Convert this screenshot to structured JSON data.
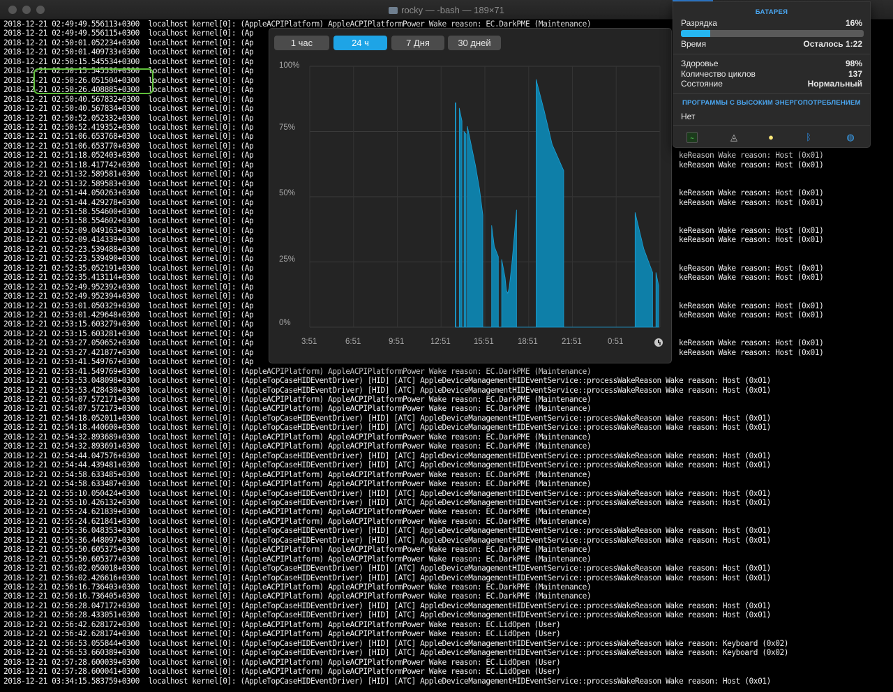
{
  "window": {
    "title": "rocky — -bash — 189×71"
  },
  "terminal": {
    "lines": [
      "2018-12-21 02:49:49.556113+0300  localhost kernel[0]: (AppleACPIPlatform) AppleACPIPlatformPower Wake reason: EC.DarkPME (Maintenance)",
      "2018-12-21 02:49:49.556115+0300  localhost kernel[0]: (Ap",
      "2018-12-21 02:50:01.052234+0300  localhost kernel[0]: (Ap",
      "2018-12-21 02:50:01.409733+0300  localhost kernel[0]: (Ap",
      "2018-12-21 02:50:15.545534+0300  localhost kernel[0]: (Ap",
      "2018-12-21 02:50:15.545536+0300  localhost kernel[0]: (Ap",
      "2018-12-21 02:50:26.051504+0300  localhost kernel[0]: (Ap",
      "2018-12-21 02:50:26.408885+0300  localhost kernel[0]: (Ap",
      "2018-12-21 02:50:40.567832+0300  localhost kernel[0]: (Ap",
      "2018-12-21 02:50:40.567834+0300  localhost kernel[0]: (Ap",
      "2018-12-21 02:50:52.052332+0300  localhost kernel[0]: (Ap",
      "2018-12-21 02:50:52.419352+0300  localhost kernel[0]: (Ap",
      "2018-12-21 02:51:06.653768+0300  localhost kernel[0]: (Ap",
      "2018-12-21 02:51:06.653770+0300  localhost kernel[0]: (Ap",
      "2018-12-21 02:51:18.052403+0300  localhost kernel[0]: (Ap                                                                                                 keReason Wake reason: Host (0x01)",
      "2018-12-21 02:51:18.417742+0300  localhost kernel[0]: (Ap                                                                                                 keReason Wake reason: Host (0x01)",
      "2018-12-21 02:51:32.589581+0300  localhost kernel[0]: (Ap",
      "2018-12-21 02:51:32.589583+0300  localhost kernel[0]: (Ap",
      "2018-12-21 02:51:44.050263+0300  localhost kernel[0]: (Ap                                                                                                 keReason Wake reason: Host (0x01)",
      "2018-12-21 02:51:44.429278+0300  localhost kernel[0]: (Ap                                                                                                 keReason Wake reason: Host (0x01)",
      "2018-12-21 02:51:58.554600+0300  localhost kernel[0]: (Ap",
      "2018-12-21 02:51:58.554602+0300  localhost kernel[0]: (Ap",
      "2018-12-21 02:52:09.049163+0300  localhost kernel[0]: (Ap                                                                                                 keReason Wake reason: Host (0x01)",
      "2018-12-21 02:52:09.414339+0300  localhost kernel[0]: (Ap                                                                                                 keReason Wake reason: Host (0x01)",
      "2018-12-21 02:52:23.539488+0300  localhost kernel[0]: (Ap",
      "2018-12-21 02:52:23.539490+0300  localhost kernel[0]: (Ap",
      "2018-12-21 02:52:35.052191+0300  localhost kernel[0]: (Ap                                                                                                 keReason Wake reason: Host (0x01)",
      "2018-12-21 02:52:35.413114+0300  localhost kernel[0]: (Ap                                                                                                 keReason Wake reason: Host (0x01)",
      "2018-12-21 02:52:49.952392+0300  localhost kernel[0]: (Ap",
      "2018-12-21 02:52:49.952394+0300  localhost kernel[0]: (Ap",
      "2018-12-21 02:53:01.050329+0300  localhost kernel[0]: (Ap                                                                                                 keReason Wake reason: Host (0x01)",
      "2018-12-21 02:53:01.429648+0300  localhost kernel[0]: (Ap                                                                                                 keReason Wake reason: Host (0x01)",
      "2018-12-21 02:53:15.603279+0300  localhost kernel[0]: (Ap",
      "2018-12-21 02:53:15.603281+0300  localhost kernel[0]: (Ap",
      "2018-12-21 02:53:27.050652+0300  localhost kernel[0]: (Ap                                                                                                 keReason Wake reason: Host (0x01)",
      "2018-12-21 02:53:27.421877+0300  localhost kernel[0]: (Ap                                                                                                 keReason Wake reason: Host (0x01)",
      "2018-12-21 02:53:41.549767+0300  localhost kernel[0]: (Ap",
      "2018-12-21 02:53:41.549769+0300  localhost kernel[0]: (AppleACPIPlatform) AppleACPIPlatformPower Wake reason: EC.DarkPME (Maintenance)",
      "2018-12-21 02:53:53.048098+0300  localhost kernel[0]: (AppleTopCaseHIDEventDriver) [HID] [ATC] AppleDeviceManagementHIDEventService::processWakeReason Wake reason: Host (0x01)",
      "2018-12-21 02:53:53.428430+0300  localhost kernel[0]: (AppleTopCaseHIDEventDriver) [HID] [ATC] AppleDeviceManagementHIDEventService::processWakeReason Wake reason: Host (0x01)",
      "2018-12-21 02:54:07.572171+0300  localhost kernel[0]: (AppleACPIPlatform) AppleACPIPlatformPower Wake reason: EC.DarkPME (Maintenance)",
      "2018-12-21 02:54:07.572173+0300  localhost kernel[0]: (AppleACPIPlatform) AppleACPIPlatformPower Wake reason: EC.DarkPME (Maintenance)",
      "2018-12-21 02:54:18.052011+0300  localhost kernel[0]: (AppleTopCaseHIDEventDriver) [HID] [ATC] AppleDeviceManagementHIDEventService::processWakeReason Wake reason: Host (0x01)",
      "2018-12-21 02:54:18.440600+0300  localhost kernel[0]: (AppleTopCaseHIDEventDriver) [HID] [ATC] AppleDeviceManagementHIDEventService::processWakeReason Wake reason: Host (0x01)",
      "2018-12-21 02:54:32.893689+0300  localhost kernel[0]: (AppleACPIPlatform) AppleACPIPlatformPower Wake reason: EC.DarkPME (Maintenance)",
      "2018-12-21 02:54:32.893691+0300  localhost kernel[0]: (AppleACPIPlatform) AppleACPIPlatformPower Wake reason: EC.DarkPME (Maintenance)",
      "2018-12-21 02:54:44.047576+0300  localhost kernel[0]: (AppleTopCaseHIDEventDriver) [HID] [ATC] AppleDeviceManagementHIDEventService::processWakeReason Wake reason: Host (0x01)",
      "2018-12-21 02:54:44.439481+0300  localhost kernel[0]: (AppleTopCaseHIDEventDriver) [HID] [ATC] AppleDeviceManagementHIDEventService::processWakeReason Wake reason: Host (0x01)",
      "2018-12-21 02:54:58.633485+0300  localhost kernel[0]: (AppleACPIPlatform) AppleACPIPlatformPower Wake reason: EC.DarkPME (Maintenance)",
      "2018-12-21 02:54:58.633487+0300  localhost kernel[0]: (AppleACPIPlatform) AppleACPIPlatformPower Wake reason: EC.DarkPME (Maintenance)",
      "2018-12-21 02:55:10.050424+0300  localhost kernel[0]: (AppleTopCaseHIDEventDriver) [HID] [ATC] AppleDeviceManagementHIDEventService::processWakeReason Wake reason: Host (0x01)",
      "2018-12-21 02:55:10.426132+0300  localhost kernel[0]: (AppleTopCaseHIDEventDriver) [HID] [ATC] AppleDeviceManagementHIDEventService::processWakeReason Wake reason: Host (0x01)",
      "2018-12-21 02:55:24.621839+0300  localhost kernel[0]: (AppleACPIPlatform) AppleACPIPlatformPower Wake reason: EC.DarkPME (Maintenance)",
      "2018-12-21 02:55:24.621841+0300  localhost kernel[0]: (AppleACPIPlatform) AppleACPIPlatformPower Wake reason: EC.DarkPME (Maintenance)",
      "2018-12-21 02:55:36.048353+0300  localhost kernel[0]: (AppleTopCaseHIDEventDriver) [HID] [ATC] AppleDeviceManagementHIDEventService::processWakeReason Wake reason: Host (0x01)",
      "2018-12-21 02:55:36.448097+0300  localhost kernel[0]: (AppleTopCaseHIDEventDriver) [HID] [ATC] AppleDeviceManagementHIDEventService::processWakeReason Wake reason: Host (0x01)",
      "2018-12-21 02:55:50.605375+0300  localhost kernel[0]: (AppleACPIPlatform) AppleACPIPlatformPower Wake reason: EC.DarkPME (Maintenance)",
      "2018-12-21 02:55:50.605377+0300  localhost kernel[0]: (AppleACPIPlatform) AppleACPIPlatformPower Wake reason: EC.DarkPME (Maintenance)",
      "2018-12-21 02:56:02.050018+0300  localhost kernel[0]: (AppleTopCaseHIDEventDriver) [HID] [ATC] AppleDeviceManagementHIDEventService::processWakeReason Wake reason: Host (0x01)",
      "2018-12-21 02:56:02.426616+0300  localhost kernel[0]: (AppleTopCaseHIDEventDriver) [HID] [ATC] AppleDeviceManagementHIDEventService::processWakeReason Wake reason: Host (0x01)",
      "2018-12-21 02:56:16.736403+0300  localhost kernel[0]: (AppleACPIPlatform) AppleACPIPlatformPower Wake reason: EC.DarkPME (Maintenance)",
      "2018-12-21 02:56:16.736405+0300  localhost kernel[0]: (AppleACPIPlatform) AppleACPIPlatformPower Wake reason: EC.DarkPME (Maintenance)",
      "2018-12-21 02:56:28.047172+0300  localhost kernel[0]: (AppleTopCaseHIDEventDriver) [HID] [ATC] AppleDeviceManagementHIDEventService::processWakeReason Wake reason: Host (0x01)",
      "2018-12-21 02:56:28.433051+0300  localhost kernel[0]: (AppleTopCaseHIDEventDriver) [HID] [ATC] AppleDeviceManagementHIDEventService::processWakeReason Wake reason: Host (0x01)",
      "2018-12-21 02:56:42.628172+0300  localhost kernel[0]: (AppleACPIPlatform) AppleACPIPlatformPower Wake reason: EC.LidOpen (User)",
      "2018-12-21 02:56:42.628174+0300  localhost kernel[0]: (AppleACPIPlatform) AppleACPIPlatformPower Wake reason: EC.LidOpen (User)",
      "2018-12-21 02:56:53.055844+0300  localhost kernel[0]: (AppleTopCaseHIDEventDriver) [HID] [ATC] AppleDeviceManagementHIDEventService::processWakeReason Wake reason: Keyboard (0x02)",
      "2018-12-21 02:56:53.660389+0300  localhost kernel[0]: (AppleTopCaseHIDEventDriver) [HID] [ATC] AppleDeviceManagementHIDEventService::processWakeReason Wake reason: Keyboard (0x02)",
      "2018-12-21 02:57:28.600039+0300  localhost kernel[0]: (AppleACPIPlatform) AppleACPIPlatformPower Wake reason: EC.LidOpen (User)",
      "2018-12-21 02:57:28.600041+0300  localhost kernel[0]: (AppleACPIPlatform) AppleACPIPlatformPower Wake reason: EC.LidOpen (User)",
      "2018-12-21 03:34:15.583759+0300  localhost kernel[0]: (AppleTopCaseHIDEventDriver) [HID] [ATC] AppleDeviceManagementHIDEventService::processWakeReason Wake reason: Host (0x01)"
    ]
  },
  "history_popup": {
    "range_buttons": [
      "1 час",
      "24 ч",
      "7 Дня",
      "30 дней"
    ],
    "active_range": "24 ч",
    "clock_icon": "clock-icon"
  },
  "chart_data": {
    "type": "area",
    "title": "",
    "xlabel": "",
    "ylabel": "",
    "ylim": [
      0,
      100
    ],
    "yticks": [
      "100%",
      "75%",
      "50%",
      "25%",
      "0%"
    ],
    "xticks": [
      "3:51",
      "6:51",
      "9:51",
      "12:51",
      "15:51",
      "18:51",
      "21:51",
      "0:51"
    ],
    "grid": true,
    "fill_color": "#0e7fa8",
    "series": [
      {
        "values": [
          [
            10.8,
            86
          ],
          [
            10.85,
            86
          ],
          [
            10.85,
            0
          ],
          [
            11.1,
            0
          ],
          [
            11.1,
            84
          ],
          [
            11.3,
            79
          ],
          [
            11.3,
            0
          ],
          [
            11.45,
            0
          ],
          [
            11.45,
            75
          ],
          [
            11.6,
            74
          ],
          [
            11.6,
            0
          ],
          [
            11.7,
            0
          ],
          [
            11.7,
            77
          ],
          [
            12.3,
            62
          ],
          [
            12.6,
            53
          ],
          [
            12.85,
            43
          ],
          [
            12.85,
            0
          ],
          [
            13.5,
            0
          ],
          [
            13.5,
            39
          ],
          [
            13.7,
            31
          ],
          [
            14.0,
            27
          ],
          [
            14.0,
            0
          ],
          [
            14.25,
            0
          ],
          [
            14.25,
            26
          ],
          [
            14.5,
            19
          ],
          [
            14.6,
            14
          ],
          [
            14.7,
            13
          ],
          [
            14.8,
            15
          ],
          [
            15.0,
            24
          ],
          [
            15.2,
            36
          ],
          [
            15.35,
            45
          ],
          [
            15.35,
            0
          ],
          [
            16.8,
            0
          ],
          [
            16.8,
            95
          ],
          [
            17.4,
            83
          ],
          [
            18.0,
            70
          ],
          [
            18.85,
            60
          ],
          [
            18.85,
            0
          ],
          [
            24.15,
            0
          ],
          [
            24.15,
            44
          ],
          [
            24.8,
            30
          ],
          [
            25.45,
            21
          ],
          [
            25.45,
            0
          ],
          [
            25.7,
            0
          ],
          [
            25.7,
            21
          ],
          [
            25.9,
            16
          ],
          [
            25.9,
            0
          ]
        ]
      }
    ]
  },
  "battery_menu": {
    "header": "БАТАРЕЯ",
    "charge_label": "Разрядка",
    "charge_value": "16%",
    "charge_level": 0.16,
    "time_label": "Время",
    "time_value": "Осталось 1:22",
    "health_label": "Здоровье",
    "health_value": "98%",
    "cycles_label": "Количество циклов",
    "cycles_value": "137",
    "condition_label": "Состояние",
    "condition_value": "Нормальный",
    "apps_title": "ПРОГРАММЫ С ВЫСОКИМ ЭНЕРГОПОТРЕБЛЕНИЕМ",
    "apps_none": "Нет",
    "icons": [
      "activity-monitor-icon",
      "airdrop-icon",
      "lightbulb-icon",
      "bluetooth-icon",
      "safari-icon"
    ]
  }
}
